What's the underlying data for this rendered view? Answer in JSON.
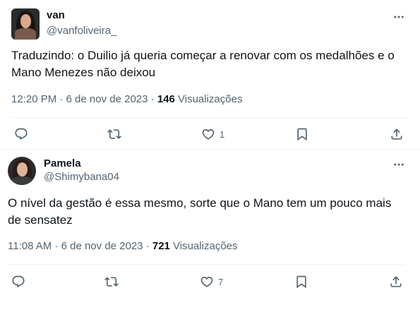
{
  "tweets": [
    {
      "name": "van",
      "handle": "@vanfoliveira_",
      "text": "Traduzindo: o Duilio já queria começar a renovar com os medalhões e o Mano Menezes não deixou",
      "time": "12:20 PM · 6 de nov de 2023 · ",
      "views_count": "146",
      "views_label": " Visualizações",
      "likes": "1"
    },
    {
      "name": "Pamela",
      "handle": "@Shimybana04",
      "text": "O nível da gestão é essa mesmo, sorte que o Mano tem um pouco mais de sensatez",
      "time": "11:08 AM · 6 de nov de 2023 · ",
      "views_count": "721",
      "views_label": " Visualizações",
      "likes": "7"
    }
  ],
  "icons": [
    "more-icon",
    "reply-icon",
    "retweet-icon",
    "like-icon",
    "bookmark-icon",
    "share-icon"
  ],
  "colors": {
    "secondary_text": "#536471",
    "primary_text": "#0f1419",
    "divider": "#eff3f4"
  }
}
